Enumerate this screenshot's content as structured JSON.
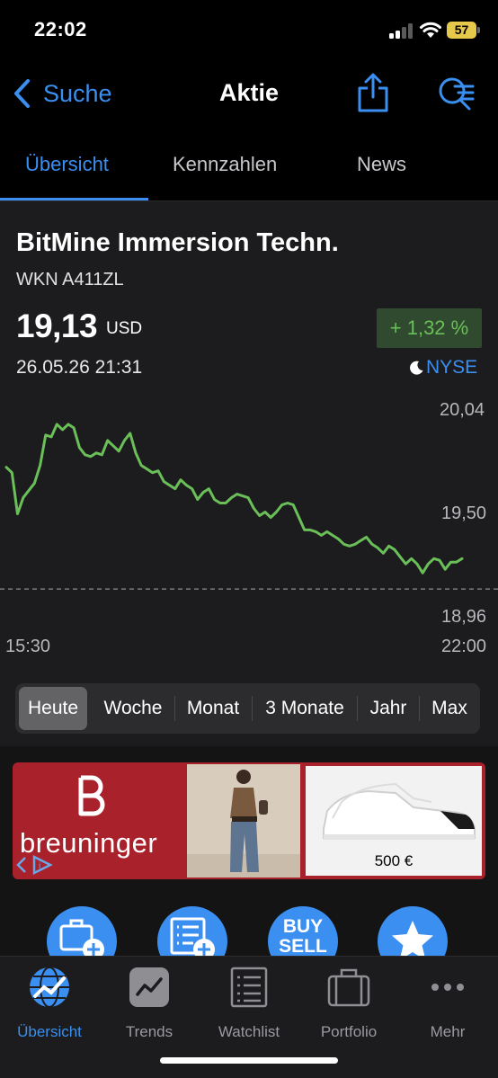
{
  "status_bar": {
    "time": "22:02",
    "battery": "57"
  },
  "nav": {
    "back_label": "Suche",
    "title": "Aktie"
  },
  "tabs": [
    {
      "label": "Übersicht"
    },
    {
      "label": "Kennzahlen"
    },
    {
      "label": "News"
    }
  ],
  "stock": {
    "name": "BitMine Immersion Techn.",
    "wkn": "WKN A411ZL",
    "price": "19,13",
    "currency": "USD",
    "datetime": "26.05.26 21:31",
    "change": "+ 1,32 %",
    "exchange": "NYSE",
    "colors": {
      "positive": "#6bbf59",
      "accent": "#3a8ff0"
    }
  },
  "chart_data": {
    "type": "line",
    "x_start": "15:30",
    "x_end": "22:00",
    "y_ticks": [
      "20,04",
      "19,50",
      "18,96"
    ],
    "ylim": [
      18.96,
      20.04
    ],
    "reference_line": 19.06,
    "color": "#6bbf59",
    "values": [
      19.74,
      19.71,
      19.48,
      19.57,
      19.61,
      19.65,
      19.75,
      19.92,
      19.91,
      19.98,
      19.95,
      19.98,
      19.96,
      19.85,
      19.81,
      19.8,
      19.82,
      19.81,
      19.89,
      19.86,
      19.83,
      19.89,
      19.93,
      19.82,
      19.75,
      19.73,
      19.71,
      19.72,
      19.66,
      19.64,
      19.62,
      19.67,
      19.64,
      19.62,
      19.56,
      19.6,
      19.62,
      19.56,
      19.54,
      19.54,
      19.57,
      19.59,
      19.58,
      19.57,
      19.51,
      19.47,
      19.49,
      19.46,
      19.49,
      19.53,
      19.54,
      19.53,
      19.46,
      19.39,
      19.39,
      19.38,
      19.36,
      19.38,
      19.36,
      19.34,
      19.31,
      19.3,
      19.31,
      19.33,
      19.35,
      19.31,
      19.29,
      19.26,
      19.3,
      19.28,
      19.24,
      19.2,
      19.23,
      19.2,
      19.15,
      19.2,
      19.23,
      19.22,
      19.17,
      19.21,
      19.21,
      19.23
    ]
  },
  "periods": [
    {
      "label": "Heute",
      "active": true
    },
    {
      "label": "Woche"
    },
    {
      "label": "Monat"
    },
    {
      "label": "3 Monate"
    },
    {
      "label": "Jahr"
    },
    {
      "label": "Max"
    }
  ],
  "ad": {
    "brand": "breuninger",
    "price": "500 €",
    "brand_color": "#a8212b"
  },
  "actions": [
    {
      "icon": "portfolio-add-icon"
    },
    {
      "icon": "watchlist-add-icon"
    },
    {
      "icon": "buy-sell-icon",
      "label": "BUY SELL"
    },
    {
      "icon": "star-icon"
    }
  ],
  "tab_bar": [
    {
      "label": "Übersicht",
      "icon": "globe-chart-icon",
      "active": true
    },
    {
      "label": "Trends",
      "icon": "trend-icon"
    },
    {
      "label": "Watchlist",
      "icon": "list-icon"
    },
    {
      "label": "Portfolio",
      "icon": "briefcase-icon"
    },
    {
      "label": "Mehr",
      "icon": "more-icon"
    }
  ]
}
